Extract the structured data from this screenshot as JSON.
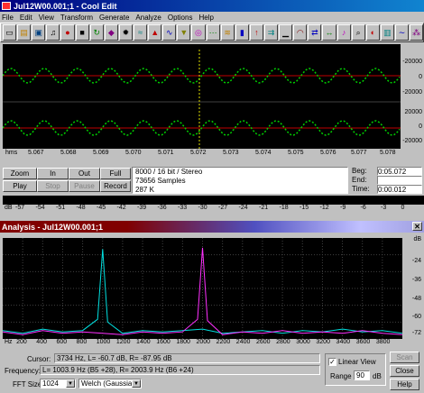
{
  "window": {
    "title": "Jul12W00.001;1 - Cool Edit"
  },
  "menu": [
    "File",
    "Edit",
    "View",
    "Transform",
    "Generate",
    "Analyze",
    "Options",
    "Help"
  ],
  "toolbar_icons": [
    "new-icon",
    "open-icon",
    "save-icon",
    "headphones-icon",
    "record-icon",
    "stop-icon",
    "loop-icon",
    "cue-icon",
    "bomb-icon",
    "noise-icon",
    "dynamics-icon",
    "wave-icon",
    "filter-icon",
    "reverb-icon",
    "echo-icon",
    "flanger-icon",
    "gain-icon",
    "amplify-icon",
    "delay-icon",
    "silence-icon",
    "envelope-icon",
    "channel-icon",
    "stretch-icon",
    "pitch-icon",
    "scan-icon",
    "stereo-icon",
    "fft-icon",
    "tone-icon",
    "noise-gen-icon"
  ],
  "wave": {
    "db_scale_top": [
      "-20000",
      "0",
      "-20000"
    ],
    "db_scale_bottom": [
      "20000",
      "0",
      "-20000"
    ],
    "ruler_unit": "hms",
    "ruler_ticks": [
      "5.067",
      "5.068",
      "5.069",
      "5.070",
      "5.071",
      "5.072",
      "5.073",
      "5.074",
      "5.075",
      "5.076",
      "5.077",
      "5.078"
    ]
  },
  "transport": {
    "zoom": "Zoom",
    "in": "In",
    "out": "Out",
    "full": "Full",
    "play": "Play",
    "stop": "Stop",
    "pause": "Pause",
    "record": "Record"
  },
  "info": {
    "format": "8000 / 16 bit / Stereo",
    "samples": "73656 Samples",
    "size": "287 K"
  },
  "times": {
    "beg_label": "Beg:",
    "beg_value": "0:05.072",
    "end_label": "End:",
    "end_value": "",
    "time_label": "Time:",
    "time_value": "0:00.012"
  },
  "level_scale": [
    "dB",
    "-57",
    "-54",
    "-51",
    "-48",
    "-45",
    "-42",
    "-39",
    "-36",
    "-33",
    "-30",
    "-27",
    "-24",
    "-21",
    "-18",
    "-15",
    "-12",
    "-9",
    "-6",
    "-3",
    "0"
  ],
  "analysis": {
    "title": "Analysis - Jul12W00.001;1",
    "db_label": "dB",
    "db_ticks": [
      "-24",
      "-36",
      "-48",
      "-60",
      "-72"
    ],
    "hz_label": "Hz",
    "hz_ticks": [
      "200",
      "400",
      "600",
      "800",
      "1000",
      "1200",
      "1400",
      "1600",
      "1800",
      "2000",
      "2200",
      "2400",
      "2600",
      "2800",
      "3000",
      "3200",
      "3400",
      "3600",
      "3800"
    ],
    "cursor_label": "Cursor:",
    "cursor_value": "3734 Hz, L= -60.7 dB, R= -87.95 dB",
    "frequency_label": "Frequency:",
    "frequency_value": "L= 1003.9 Hz (B5 +28), R= 2003.9 Hz (B6 +24)",
    "fft_label": "FFT Size",
    "fft_value": "1024",
    "window_value": "Welch (Gaussian)",
    "linear_view_label": "Linear View",
    "linear_view_checked": true,
    "range_label": "Range",
    "range_value": "90",
    "range_unit": "dB",
    "scan_label": "Scan",
    "close_label": "Close",
    "help_label": "Help"
  },
  "chart_data": {
    "type": "line",
    "xlabel": "Hz",
    "ylabel": "dB",
    "xlim": [
      0,
      4000
    ],
    "ylim": [
      -84,
      -12
    ],
    "series": [
      {
        "color": "#00e0e0",
        "x": [
          0,
          200,
          400,
          600,
          800,
          950,
          1000,
          1050,
          1200,
          1400,
          1600,
          1800,
          2000,
          2200,
          2400,
          2600,
          2800,
          3000,
          3200,
          3400,
          3600,
          3800,
          4000
        ],
        "y": [
          -78,
          -80,
          -77,
          -79,
          -78,
          -70,
          -20,
          -72,
          -80,
          -78,
          -79,
          -78,
          -77,
          -80,
          -79,
          -78,
          -80,
          -78,
          -79,
          -77,
          -79,
          -78,
          -80
        ]
      },
      {
        "color": "#ff30ff",
        "x": [
          0,
          200,
          400,
          600,
          800,
          1000,
          1200,
          1400,
          1600,
          1800,
          1950,
          2000,
          2050,
          2200,
          2400,
          2600,
          2800,
          3000,
          3200,
          3400,
          3600,
          3800,
          4000
        ],
        "y": [
          -79,
          -81,
          -78,
          -80,
          -79,
          -80,
          -81,
          -79,
          -80,
          -79,
          -70,
          -19,
          -71,
          -81,
          -79,
          -80,
          -78,
          -80,
          -79,
          -80,
          -78,
          -80,
          -81
        ]
      }
    ]
  }
}
